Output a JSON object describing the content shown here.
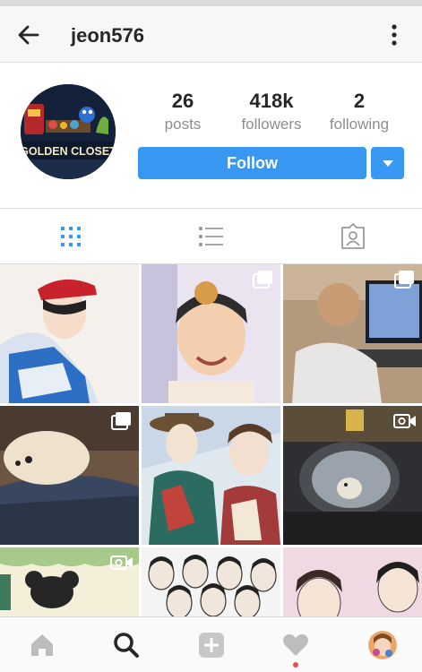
{
  "header": {
    "username": "jeon576",
    "back_icon": "arrow-left-icon",
    "menu_icon": "more-vertical-icon"
  },
  "profile": {
    "avatar_text": "GOLDEN CLOSET",
    "stats": [
      {
        "value": "26",
        "label": "posts"
      },
      {
        "value": "418k",
        "label": "followers"
      },
      {
        "value": "2",
        "label": "following"
      }
    ],
    "follow_label": "Follow",
    "accent": "#3897f0"
  },
  "tabs": [
    {
      "name": "grid-view",
      "icon": "grid-icon",
      "active": true
    },
    {
      "name": "list-view",
      "icon": "list-icon",
      "active": false
    },
    {
      "name": "tagged",
      "icon": "tagged-icon",
      "active": false
    }
  ],
  "grid": {
    "posts": [
      {
        "subject": "illustration boy red cap blue jacket",
        "badge": "none"
      },
      {
        "subject": "child photo with teddy bear",
        "badge": "multiple"
      },
      {
        "subject": "person at computer",
        "badge": "multiple"
      },
      {
        "subject": "white puppy on blanket",
        "badge": "multiple"
      },
      {
        "subject": "illustration two boys hat",
        "badge": "none"
      },
      {
        "subject": "car side mirror",
        "badge": "video"
      },
      {
        "subject": "drawing with bear",
        "badge": "video"
      },
      {
        "subject": "group sketch portraits",
        "badge": "none"
      },
      {
        "subject": "sketch faces pink",
        "badge": "none"
      }
    ]
  },
  "bottom_nav": [
    {
      "name": "home",
      "icon": "home-icon"
    },
    {
      "name": "search",
      "icon": "search-icon"
    },
    {
      "name": "add",
      "icon": "plus-square-icon"
    },
    {
      "name": "activity",
      "icon": "heart-icon",
      "notification": true
    },
    {
      "name": "profile",
      "icon": "avatar-icon"
    }
  ]
}
